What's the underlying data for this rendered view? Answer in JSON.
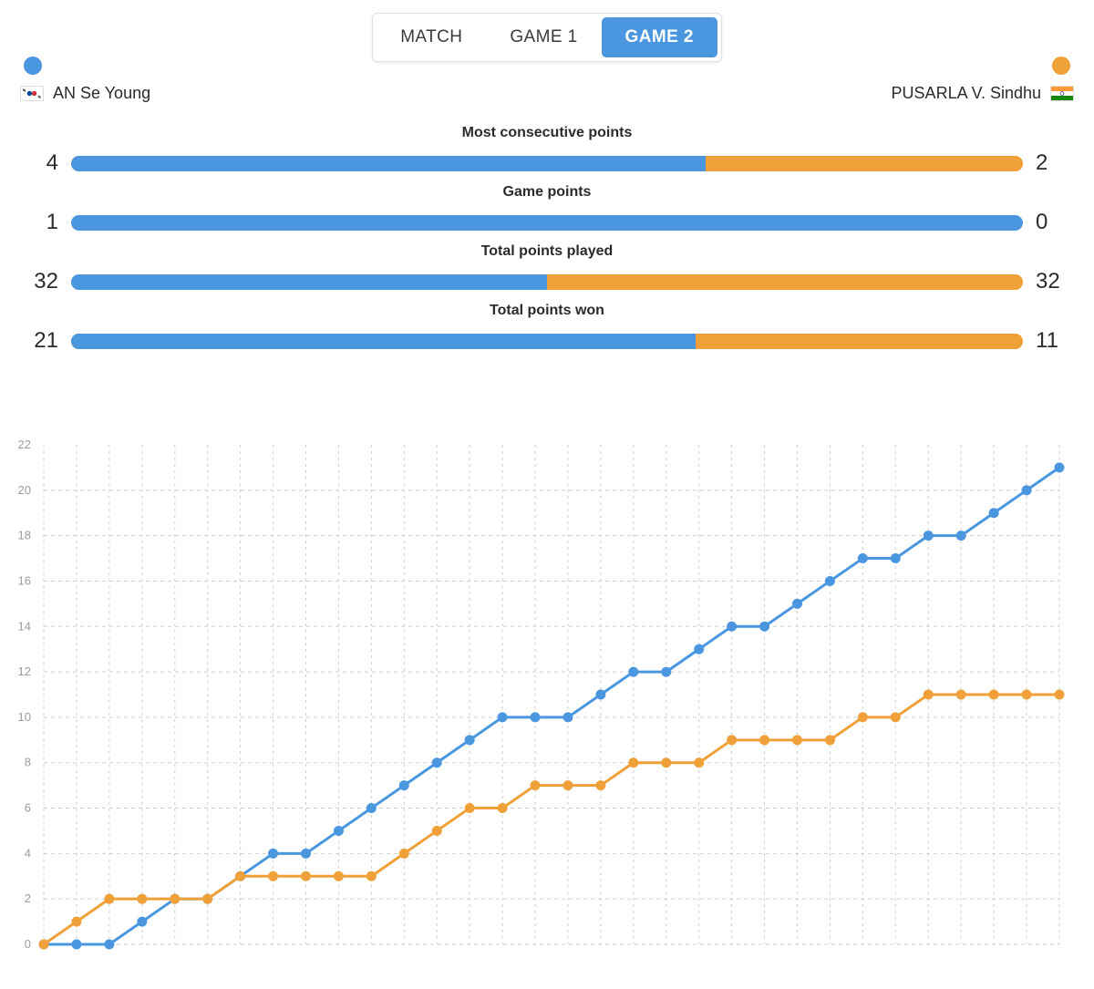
{
  "tabs": [
    {
      "label": "MATCH",
      "active": false
    },
    {
      "label": "GAME 1",
      "active": false
    },
    {
      "label": "GAME 2",
      "active": true
    }
  ],
  "players": {
    "left": {
      "name": "AN Se Young",
      "color": "#4a97e0",
      "flag": "kr-flag-icon"
    },
    "right": {
      "name": "PUSARLA V. Sindhu",
      "color": "#efa038",
      "flag": "in-flag-icon"
    }
  },
  "stats": [
    {
      "label": "Most consecutive points",
      "left": "4",
      "right": "2",
      "left_pct": 66.7
    },
    {
      "label": "Game points",
      "left": "1",
      "right": "0",
      "left_pct": 100
    },
    {
      "label": "Total points played",
      "left": "32",
      "right": "32",
      "left_pct": 50
    },
    {
      "label": "Total points won",
      "left": "21",
      "right": "11",
      "left_pct": 65.6
    }
  ],
  "chart_data": {
    "type": "line",
    "title": "",
    "xlabel": "",
    "ylabel": "",
    "ylim": [
      0,
      22
    ],
    "yticks": [
      0,
      2,
      4,
      6,
      8,
      10,
      12,
      14,
      16,
      18,
      20,
      22
    ],
    "grid": true,
    "legend_position": "none",
    "x": [
      1,
      2,
      3,
      4,
      5,
      6,
      7,
      8,
      9,
      10,
      11,
      12,
      13,
      14,
      15,
      16,
      17,
      18,
      19,
      20,
      21,
      22,
      23,
      24,
      25,
      26,
      27,
      28,
      29,
      30,
      31,
      32
    ],
    "series": [
      {
        "name": "AN Se Young",
        "color": "#4a97e0",
        "values": [
          0,
          0,
          0,
          1,
          2,
          2,
          3,
          4,
          4,
          5,
          6,
          7,
          8,
          9,
          10,
          10,
          10,
          11,
          12,
          12,
          13,
          14,
          14,
          15,
          16,
          17,
          17,
          18,
          18,
          19,
          20,
          21
        ]
      },
      {
        "name": "PUSARLA V. Sindhu",
        "color": "#efa038",
        "values": [
          0,
          1,
          2,
          2,
          2,
          2,
          3,
          3,
          3,
          3,
          3,
          4,
          5,
          6,
          6,
          7,
          7,
          7,
          8,
          8,
          8,
          9,
          9,
          9,
          9,
          10,
          10,
          11,
          11,
          11,
          11,
          11
        ]
      }
    ]
  },
  "colors": {
    "blue": "#4a97e0",
    "orange": "#efa038",
    "grid": "#cfcfcf",
    "tick": "#9b9b9b"
  }
}
